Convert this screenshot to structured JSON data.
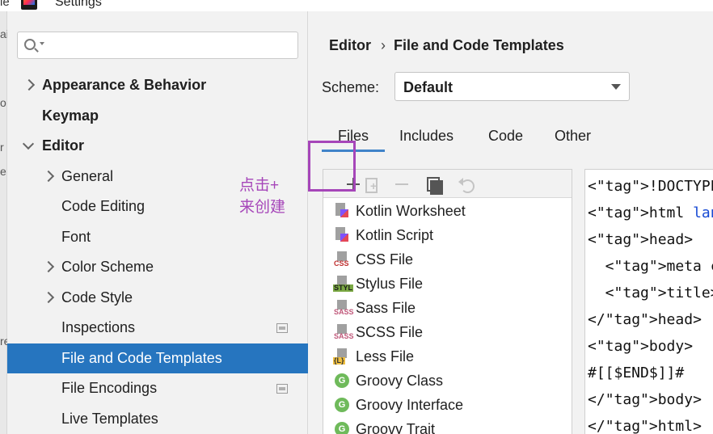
{
  "window": {
    "title": "Settings",
    "behind_window_glyphs": [
      "le",
      "ai",
      "o",
      "r",
      "e",
      "re"
    ]
  },
  "sidebar": {
    "search": {
      "placeholder": "",
      "value": ""
    },
    "items": [
      {
        "label": "Appearance & Behavior",
        "level": 0,
        "bold": true,
        "expander": "collapsed"
      },
      {
        "label": "Keymap",
        "level": 0,
        "bold": true,
        "expander": "none"
      },
      {
        "label": "Editor",
        "level": 0,
        "bold": true,
        "expander": "expanded"
      },
      {
        "label": "General",
        "level": 1,
        "expander": "collapsed"
      },
      {
        "label": "Code Editing",
        "level": 1,
        "expander": "none"
      },
      {
        "label": "Font",
        "level": 1,
        "expander": "none"
      },
      {
        "label": "Color Scheme",
        "level": 1,
        "expander": "collapsed"
      },
      {
        "label": "Code Style",
        "level": 1,
        "expander": "collapsed"
      },
      {
        "label": "Inspections",
        "level": 1,
        "expander": "none",
        "page_icon": true
      },
      {
        "label": "File and Code Templates",
        "level": 1,
        "expander": "none",
        "selected": true
      },
      {
        "label": "File Encodings",
        "level": 1,
        "expander": "none",
        "page_icon": true
      },
      {
        "label": "Live Templates",
        "level": 1,
        "expander": "none"
      }
    ],
    "selected_color": "#2675bf"
  },
  "annotation": {
    "line1": "点击+",
    "line2": "来创建",
    "color": "#a646b9"
  },
  "main": {
    "breadcrumb": {
      "parent": "Editor",
      "separator": "›",
      "current": "File and Code Templates"
    },
    "scheme": {
      "label": "Scheme:",
      "value": "Default"
    },
    "tabs": [
      {
        "label": "Files",
        "active": true
      },
      {
        "label": "Includes",
        "active": false
      },
      {
        "label": "Code",
        "active": false
      },
      {
        "label": "Other",
        "active": false
      }
    ],
    "toolbar": {
      "add": "plus-icon",
      "add_child": "copy-add-icon",
      "remove": "minus-icon",
      "copy": "copy-icon",
      "reset": "undo-icon"
    },
    "templates": [
      {
        "label": "Kotlin Worksheet",
        "icon": "kotlin",
        "badge": ""
      },
      {
        "label": "Kotlin Script",
        "icon": "kotlin",
        "badge": ""
      },
      {
        "label": "CSS File",
        "icon": "file",
        "badge": "CSS",
        "kind": "css"
      },
      {
        "label": "Stylus File",
        "icon": "file",
        "badge": "STYL",
        "kind": "styl"
      },
      {
        "label": "Sass File",
        "icon": "file",
        "badge": "SASS",
        "kind": "sass"
      },
      {
        "label": "SCSS File",
        "icon": "file",
        "badge": "SASS",
        "kind": "sass"
      },
      {
        "label": "Less File",
        "icon": "file",
        "badge": "{L}",
        "kind": "less"
      },
      {
        "label": "Groovy Class",
        "icon": "groovy",
        "badge": ""
      },
      {
        "label": "Groovy Interface",
        "icon": "groovy",
        "badge": ""
      },
      {
        "label": "Groovy Trait",
        "icon": "groovy",
        "badge": ""
      }
    ],
    "code_lines": [
      "<!DOCTYPE htm",
      "<html lang=\"e",
      "<head>",
      "  <meta chars",
      "  <title>#[[$",
      "</head>",
      "<body>",
      "#[[$END$]]#",
      "</body>",
      "</html>"
    ]
  }
}
